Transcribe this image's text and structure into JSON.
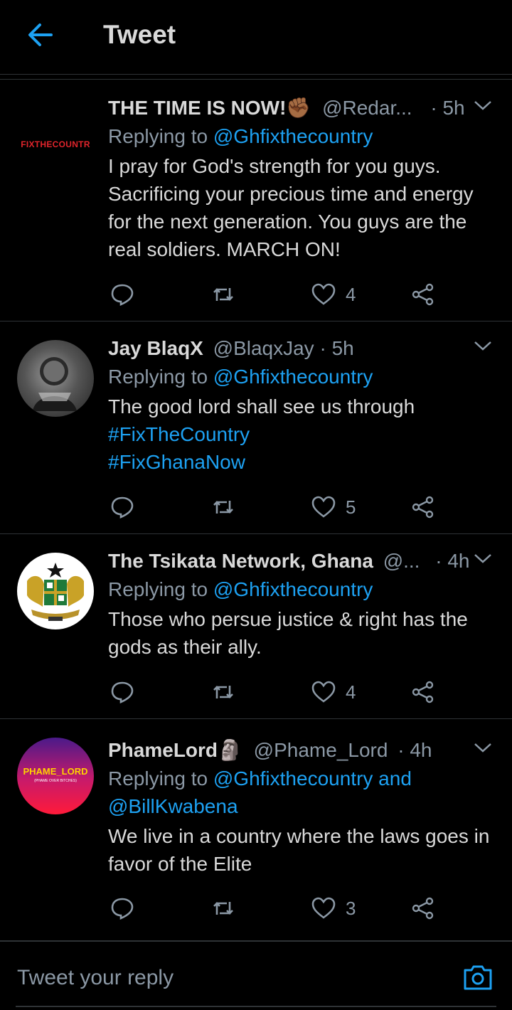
{
  "header": {
    "title": "Tweet"
  },
  "colors": {
    "accent": "#1da1f2",
    "muted": "#8b98a5",
    "text": "#d9d9d9",
    "bg": "#000000"
  },
  "tweets": [
    {
      "name": "THE TIME IS NOW!✊🏾",
      "handle": "@Redar...",
      "time": "· 5h",
      "avatar_text": "FIXTHECOUNTR",
      "replying_prefix": "Replying to ",
      "replying_to": "@Ghfixthecountry",
      "replying_extra": "",
      "body": "I pray for God's strength for you guys. Sacrificing your precious time and energy for the next generation. You guys are the real soldiers. MARCH ON!",
      "hashtags": [],
      "likes": "4"
    },
    {
      "name": "Jay BlaqX",
      "handle": "@BlaqxJay",
      "time": "· 5h",
      "avatar_text": "",
      "replying_prefix": "Replying to ",
      "replying_to": "@Ghfixthecountry",
      "replying_extra": "",
      "body": "The good lord shall see us through",
      "hashtags": [
        "#FixTheCountry",
        "#FixGhanaNow"
      ],
      "likes": "5"
    },
    {
      "name": "The Tsikata Network, Ghana",
      "handle": "@...",
      "time": "· 4h",
      "avatar_text": "",
      "replying_prefix": "Replying to ",
      "replying_to": "@Ghfixthecountry",
      "replying_extra": "",
      "body": "Those who persue justice & right has the gods as their ally.",
      "hashtags": [],
      "likes": "4"
    },
    {
      "name": "PhameLord🗿",
      "handle": "@Phame_Lord",
      "time": "· 4h",
      "avatar_text": "PHAME_LORD",
      "avatar_subtext": "(PHAME OVER BITCHES)",
      "replying_prefix": "Replying to ",
      "replying_to": "@Ghfixthecountry and @BillKwabena",
      "replying_extra": "",
      "body": "We live in a country where the laws goes in favor of the Elite",
      "hashtags": [],
      "likes": "3"
    }
  ],
  "reply_bar": {
    "placeholder": "Tweet your reply"
  }
}
